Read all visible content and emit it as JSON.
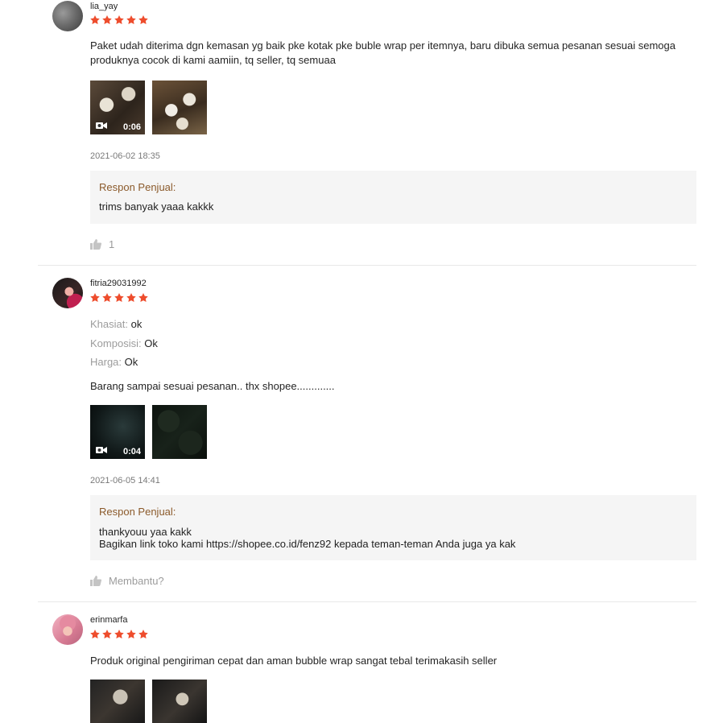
{
  "colors": {
    "star": "#ee4d2d",
    "response_title": "#8b5a2b",
    "response_bg": "#f5f5f5"
  },
  "reviews": [
    {
      "username": "lia_yay",
      "rating": 5,
      "text": "Paket udah diterima dgn kemasan yg baik pke kotak pke buble wrap per itemnya, baru dibuka semua pesanan sesuai semoga produknya cocok di kami aamiin, tq seller, tq semuaa",
      "media": [
        {
          "type": "video",
          "duration": "0:06"
        },
        {
          "type": "image"
        }
      ],
      "date": "2021-06-02 18:35",
      "seller_response": {
        "title": "Respon Penjual:",
        "lines": [
          "trims banyak yaaa kakkk"
        ]
      },
      "likes": "1"
    },
    {
      "username": "fitria29031992",
      "rating": 5,
      "attributes": [
        {
          "key": "Khasiat:",
          "value": "ok"
        },
        {
          "key": "Komposisi:",
          "value": "Ok"
        },
        {
          "key": "Harga:",
          "value": "Ok"
        }
      ],
      "text": "Barang sampai sesuai pesanan.. thx shopee.............",
      "media": [
        {
          "type": "video",
          "duration": "0:04"
        },
        {
          "type": "image"
        }
      ],
      "date": "2021-06-05 14:41",
      "seller_response": {
        "title": "Respon Penjual:",
        "lines": [
          "thankyouu yaa kakk",
          "Bagikan link toko kami https://shopee.co.id/fenz92 kepada teman-teman Anda juga ya kak"
        ]
      },
      "likes": "Membantu?"
    },
    {
      "username": "erinmarfa",
      "rating": 5,
      "text": "Produk original pengiriman cepat dan aman bubble wrap sangat tebal terimakasih seller",
      "media": [
        {
          "type": "image"
        },
        {
          "type": "image"
        }
      ]
    }
  ]
}
